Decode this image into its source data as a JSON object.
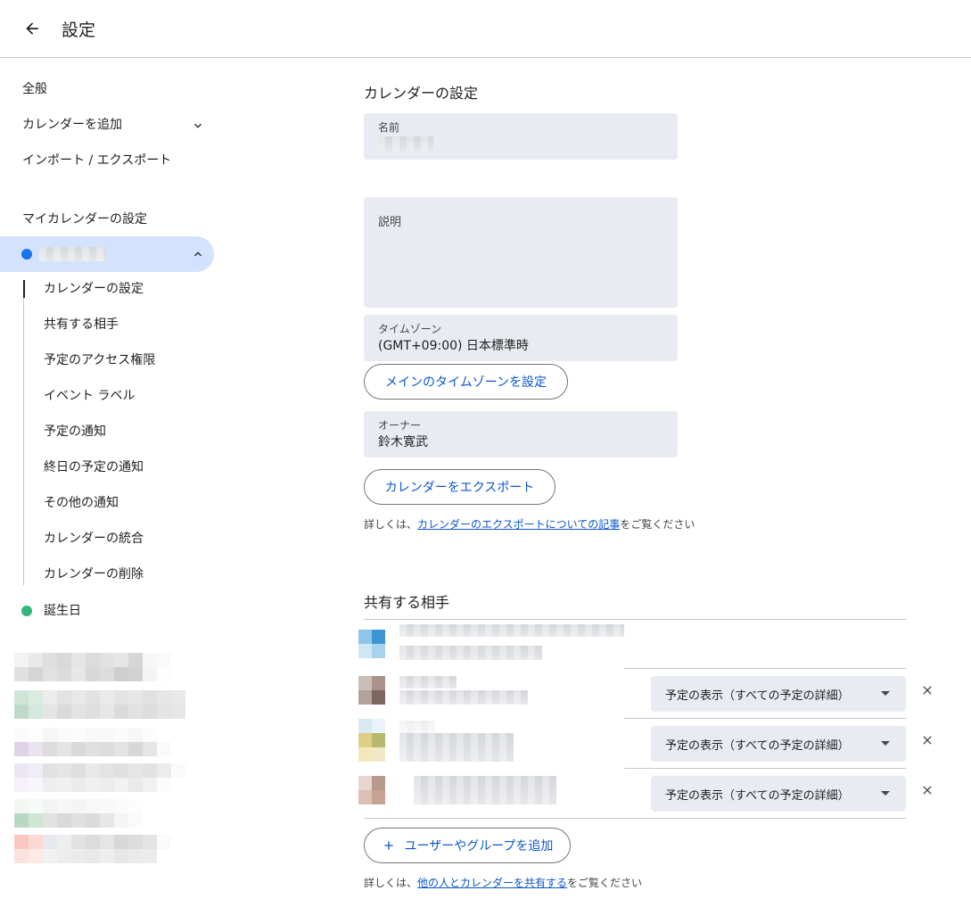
{
  "header": {
    "title": "設定",
    "back_icon": "arrow-back-icon"
  },
  "sidebar": {
    "general": "全般",
    "add_calendar": "カレンダーを追加",
    "import_export": "インポート / エクスポート",
    "my_calendars_label": "マイカレンダーの設定",
    "selected_calendar": {
      "color": "#1a73e8"
    },
    "subnav": [
      {
        "label": "カレンダーの設定",
        "active": true
      },
      {
        "label": "共有する相手"
      },
      {
        "label": "予定のアクセス権限"
      },
      {
        "label": "イベント ラベル"
      },
      {
        "label": "予定の通知"
      },
      {
        "label": "終日の予定の通知"
      },
      {
        "label": "その他の通知"
      },
      {
        "label": "カレンダーの統合"
      },
      {
        "label": "カレンダーの削除"
      }
    ],
    "birthday": {
      "label": "誕生日",
      "color": "#33b679"
    }
  },
  "main": {
    "calendar_settings_title": "カレンダーの設定",
    "name_field": {
      "label": "名前"
    },
    "description_field": {
      "label": "説明"
    },
    "timezone_field": {
      "label": "タイムゾーン",
      "value": "(GMT+09:00) 日本標準時"
    },
    "set_main_timezone_button": "メインのタイムゾーンを設定",
    "owner_field": {
      "label": "オーナー",
      "value": "鈴木寛武"
    },
    "export_button": "カレンダーをエクスポート",
    "export_help": {
      "prefix": "詳しくは、",
      "link": "カレンダーのエクスポートについての記事",
      "suffix": "をご覧ください"
    },
    "share_title": "共有する相手",
    "share_rows": [
      {
        "permission": "予定の表示（すべての予定の詳細）"
      },
      {
        "permission": "予定の表示（すべての予定の詳細）"
      },
      {
        "permission": "予定の表示（すべての予定の詳細）"
      }
    ],
    "add_people_button": "ユーザーやグループを追加",
    "share_help": {
      "prefix": "詳しくは、",
      "link": "他の人とカレンダーを共有する",
      "suffix": "をご覧ください"
    }
  },
  "colors": {
    "accent": "#0b57d0",
    "selected_bg": "#d3e3fd",
    "field_bg": "#e8ebf1"
  }
}
